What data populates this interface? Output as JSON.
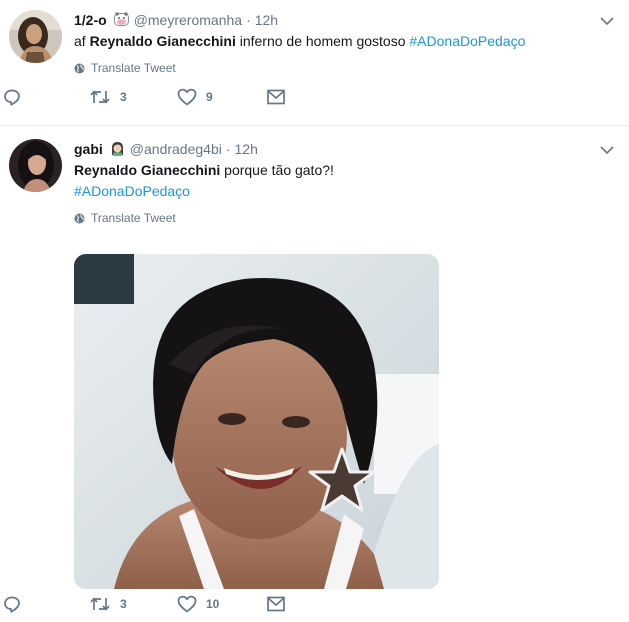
{
  "tweets": [
    {
      "display_name": "1/2-o",
      "badge_icon": "cow-emoji-icon",
      "handle": "@meyreromanha",
      "separator": "·",
      "time": "12h",
      "text_prefix": "af ",
      "mention": "Reynaldo Gianecchini",
      "text_middle": " inferno de homem gostoso ",
      "hashtag": "#ADonaDoPedaço",
      "translate_label": "Translate Tweet",
      "retweets": "3",
      "likes": "9"
    },
    {
      "display_name": "gabi",
      "badge_icon": "woman-emoji-icon",
      "handle": "@andradeg4bi",
      "separator": "·",
      "time": "12h",
      "mention": "Reynaldo Gianecchini",
      "text_suffix": " porque tão gato?!",
      "hashtag": "#ADonaDoPedaço",
      "translate_label": "Translate Tweet",
      "retweets": "3",
      "likes": "10"
    }
  ],
  "colors": {
    "link": "#1b95e0",
    "secondary_text": "#657786",
    "divider": "#e6ecf0"
  }
}
